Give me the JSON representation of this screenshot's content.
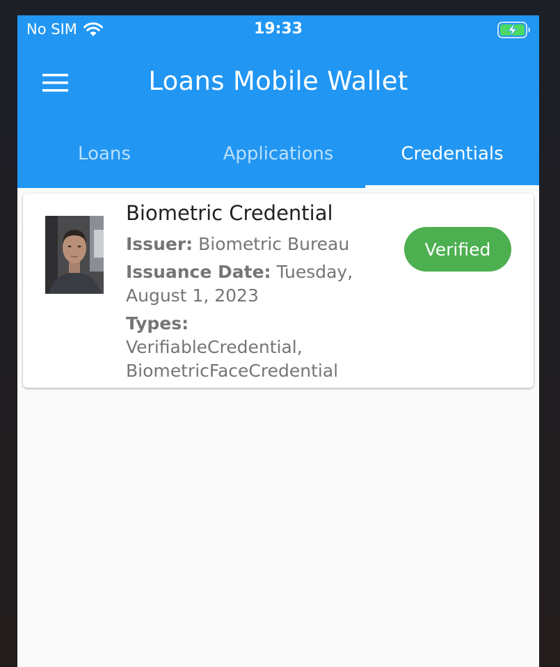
{
  "status_bar": {
    "carrier": "No SIM",
    "time": "19:33"
  },
  "app_bar": {
    "title": "Loans Mobile Wallet"
  },
  "tabs": [
    {
      "label": "Loans",
      "active": false
    },
    {
      "label": "Applications",
      "active": false
    },
    {
      "label": "Credentials",
      "active": true
    }
  ],
  "credential": {
    "title": "Biometric Credential",
    "issuer_label": "Issuer:",
    "issuer_value": "Biometric Bureau",
    "issuance_date_label": "Issuance Date:",
    "issuance_date_value": "Tuesday, August 1, 2023",
    "types_label": "Types:",
    "types_value_line1": "VerifiableCredential,",
    "types_value_line2": "BiometricFaceCredential",
    "status": "Verified"
  },
  "colors": {
    "primary": "#2196f3",
    "verified": "#4caf50",
    "background": "#fafafa"
  },
  "icons": [
    "wifi-icon",
    "battery-charging-icon",
    "hamburger-menu-icon"
  ]
}
